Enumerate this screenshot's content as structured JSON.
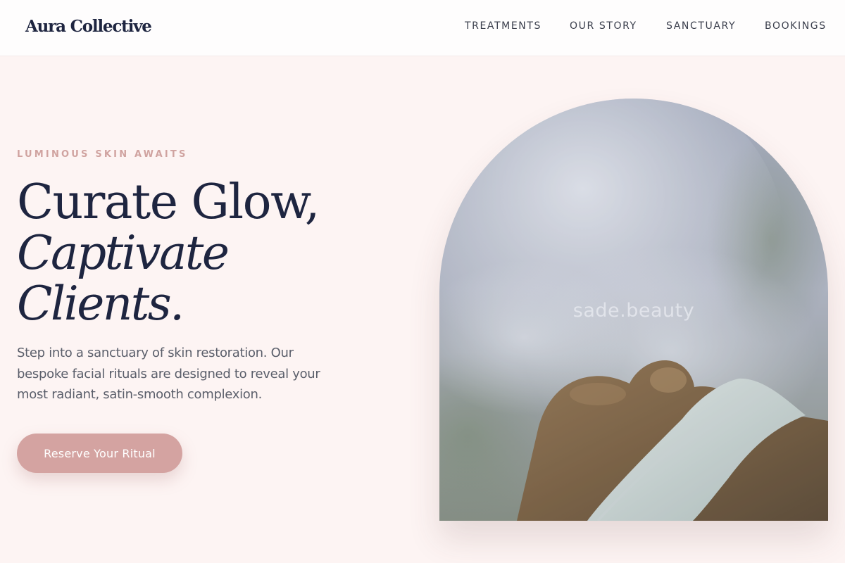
{
  "header": {
    "logo": "Aura Collective",
    "nav": [
      "TREATMENTS",
      "OUR STORY",
      "SANCTUARY",
      "BOOKINGS"
    ]
  },
  "hero": {
    "eyebrow": "LUMINOUS SKIN AWAITS",
    "headline": {
      "line1": "Curate Glow,",
      "line2": "Captivate",
      "line3": "Clients."
    },
    "lead": "Step into a sanctuary of skin restoration. Our bespoke facial rituals are designed to reveal your most radiant, satin-smooth complexion.",
    "cta_label": "Reserve Your Ritual",
    "image": {
      "watermark": "sade.beauty"
    }
  },
  "colors": {
    "page_background": "#fdf4f3",
    "header_background": "#fefdfd",
    "heading": "#1e2540",
    "accent_rose": "#d4a3a1",
    "eyebrow": "#d0a3a0",
    "body_text": "#5a5e6a"
  }
}
